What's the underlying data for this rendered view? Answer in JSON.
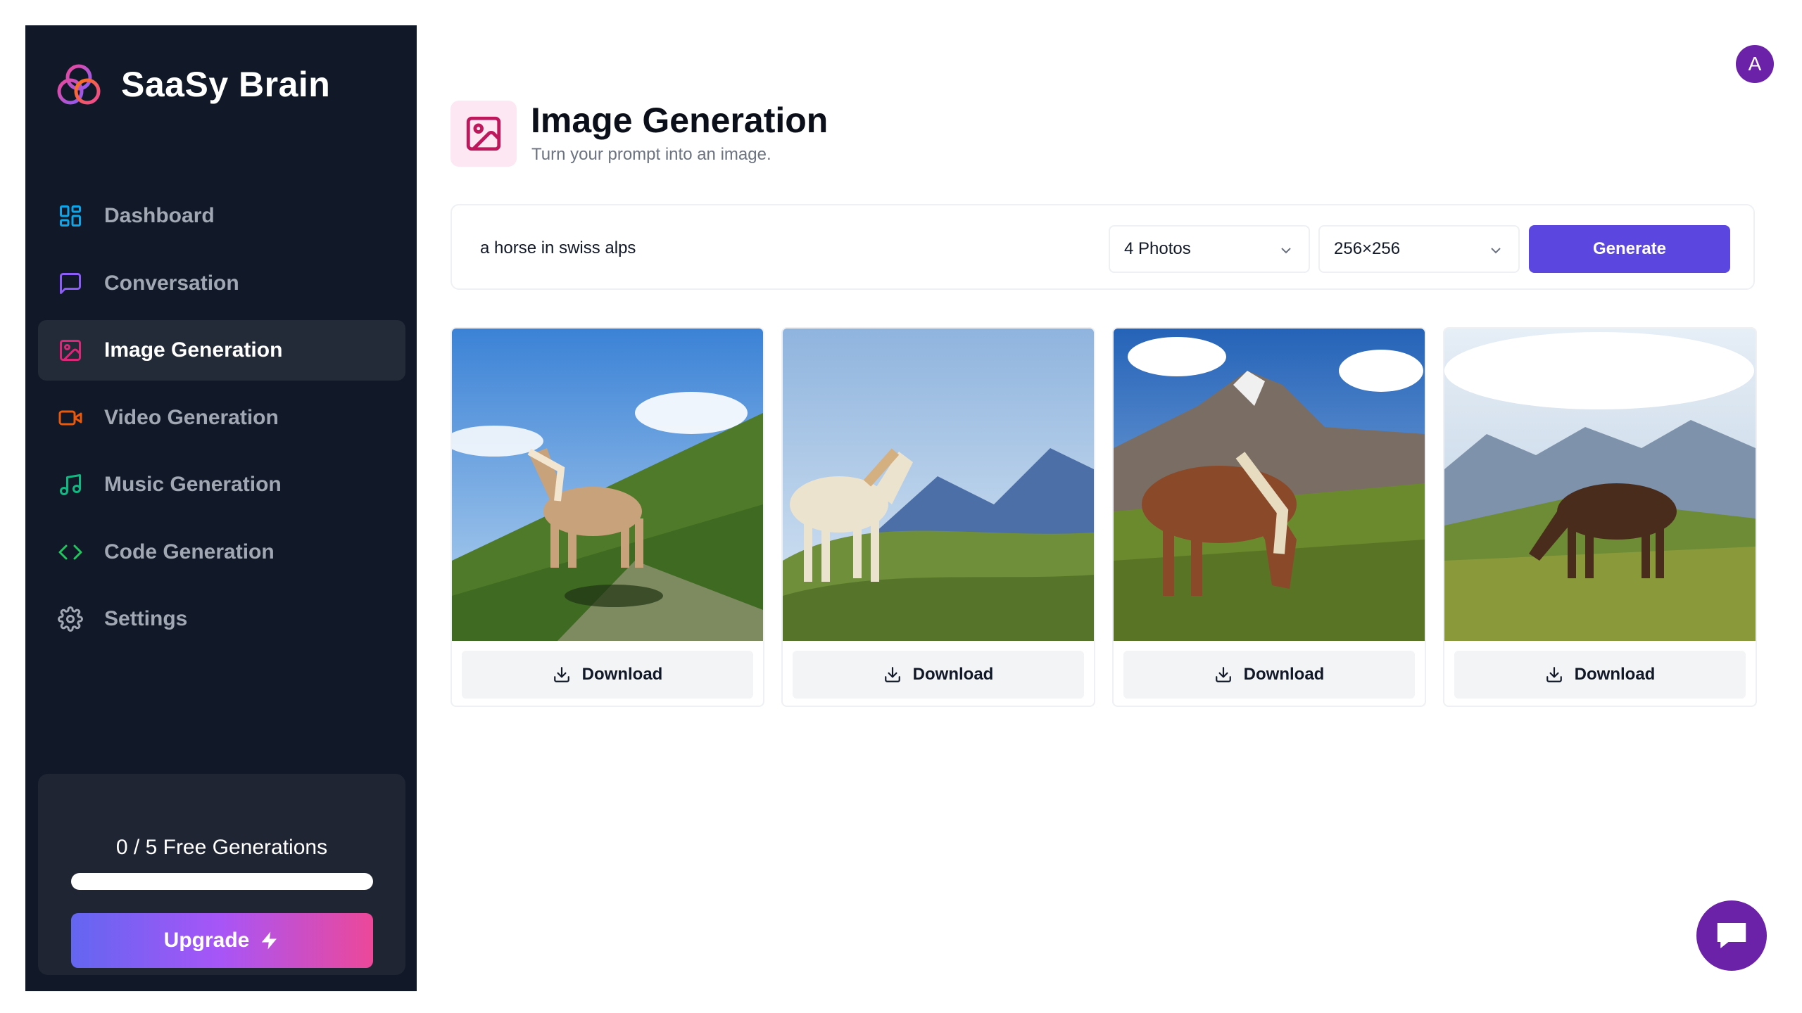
{
  "app": {
    "name": "SaaSy Brain"
  },
  "sidebar": {
    "items": [
      {
        "label": "Dashboard",
        "icon": "layout-dashboard-icon",
        "color": "#0ea5e9",
        "active": false
      },
      {
        "label": "Conversation",
        "icon": "message-square-icon",
        "color": "#8b5cf6",
        "active": false
      },
      {
        "label": "Image Generation",
        "icon": "image-icon",
        "color": "#db2777",
        "active": true
      },
      {
        "label": "Video Generation",
        "icon": "video-icon",
        "color": "#ea580c",
        "active": false
      },
      {
        "label": "Music Generation",
        "icon": "music-icon",
        "color": "#10b981",
        "active": false
      },
      {
        "label": "Code Generation",
        "icon": "code-icon",
        "color": "#22c55e",
        "active": false
      },
      {
        "label": "Settings",
        "icon": "gear-icon",
        "color": "#a1a7b3",
        "active": false
      }
    ],
    "free_generations": {
      "text": "0 / 5 Free Generations",
      "used": 0,
      "total": 5
    },
    "upgrade_label": "Upgrade"
  },
  "user": {
    "avatar_initial": "A"
  },
  "page": {
    "title": "Image Generation",
    "subtitle": "Turn your prompt into an image."
  },
  "prompt": {
    "value": "a horse in swiss alps",
    "amount": "4 Photos",
    "resolution": "256×256",
    "generate_label": "Generate"
  },
  "results": [
    {
      "download_label": "Download"
    },
    {
      "download_label": "Download"
    },
    {
      "download_label": "Download"
    },
    {
      "download_label": "Download"
    }
  ],
  "colors": {
    "sidebar_bg": "#111827",
    "accent": "#5b47e0",
    "image_accent": "#db2777",
    "avatar": "#6b21a8"
  }
}
